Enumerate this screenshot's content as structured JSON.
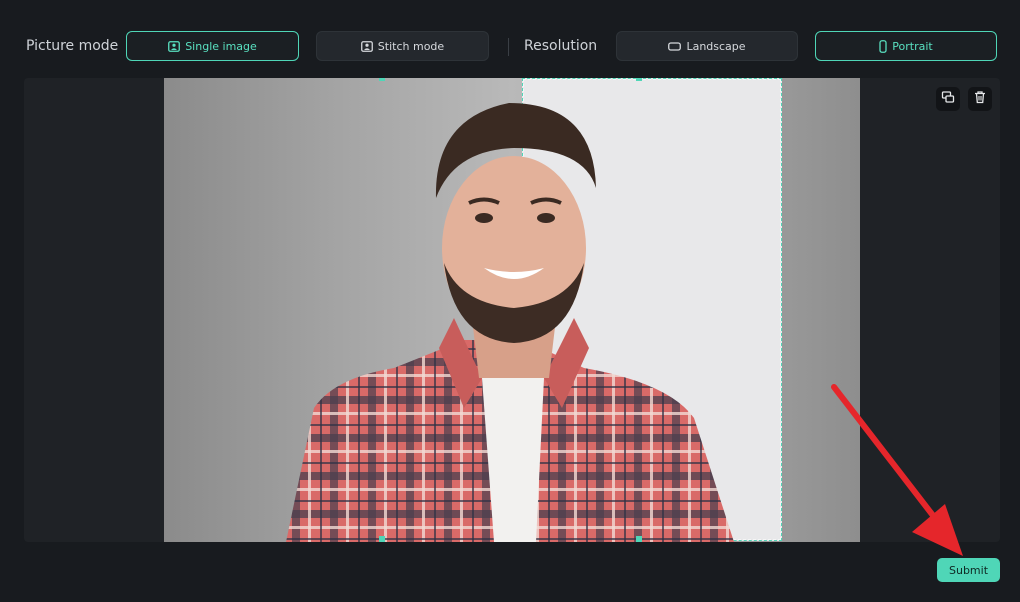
{
  "toolbar": {
    "picture_mode_label": "Picture mode",
    "single_image_label": "Single image",
    "stitch_mode_label": "Stitch mode",
    "resolution_label": "Resolution",
    "landscape_label": "Landscape",
    "portrait_label": "Portrait",
    "selected_picture_mode": "Single image",
    "selected_resolution": "Portrait"
  },
  "canvas": {
    "image_subject": "smiling bearded man in red plaid shirt",
    "crop_ratio": "portrait",
    "icons": [
      "replace-image-icon",
      "trash-icon"
    ]
  },
  "footer": {
    "submit_label": "Submit"
  },
  "colors": {
    "accent": "#4fd6b7",
    "background": "#181b1f",
    "annotation_arrow": "#e5262b"
  }
}
